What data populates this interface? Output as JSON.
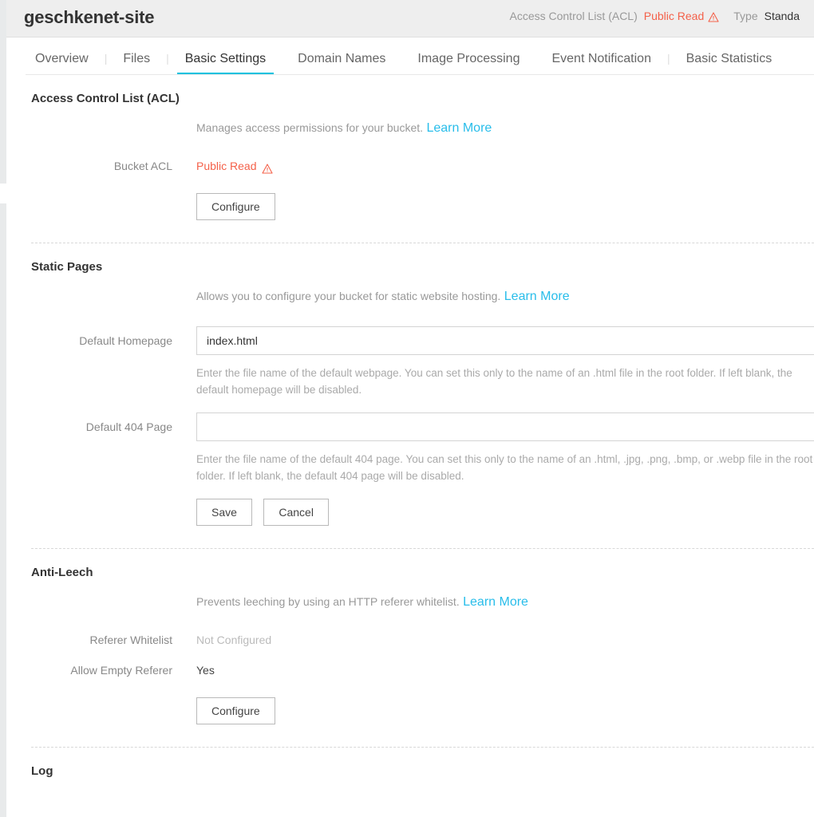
{
  "header": {
    "bucket_name": "geschkenet-site",
    "acl_label": "Access Control List (ACL)",
    "acl_value": "Public Read",
    "type_label": "Type",
    "type_value": "Standa"
  },
  "tabs": [
    {
      "label": "Overview",
      "active": false
    },
    {
      "label": "Files",
      "active": false
    },
    {
      "label": "Basic Settings",
      "active": true
    },
    {
      "label": "Domain Names",
      "active": false
    },
    {
      "label": "Image Processing",
      "active": false
    },
    {
      "label": "Event Notification",
      "active": false
    },
    {
      "label": "Basic Statistics",
      "active": false
    }
  ],
  "sections": {
    "acl": {
      "title": "Access Control List (ACL)",
      "description": "Manages access permissions for your bucket.",
      "learn_more": "Learn More",
      "bucket_acl_label": "Bucket ACL",
      "bucket_acl_value": "Public Read",
      "configure_button": "Configure"
    },
    "static_pages": {
      "title": "Static Pages",
      "description": "Allows you to configure your bucket for static website hosting.",
      "learn_more": "Learn More",
      "homepage_label": "Default Homepage",
      "homepage_value": "index.html",
      "homepage_placeholder": "",
      "homepage_helper": "Enter the file name of the default webpage. You can set this only to the name of an .html file in the root folder. If left blank, the default homepage will be disabled.",
      "notfound_label": "Default 404 Page",
      "notfound_value": "",
      "notfound_placeholder": "",
      "notfound_helper": "Enter the file name of the default 404 page. You can set this only to the name of an .html, .jpg, .png, .bmp, or .webp file in the root folder. If left blank, the default 404 page will be disabled.",
      "save_button": "Save",
      "cancel_button": "Cancel"
    },
    "anti_leech": {
      "title": "Anti-Leech",
      "description": "Prevents leeching by using an HTTP referer whitelist.",
      "learn_more": "Learn More",
      "referer_whitelist_label": "Referer Whitelist",
      "referer_whitelist_value": "Not Configured",
      "allow_empty_referer_label": "Allow Empty Referer",
      "allow_empty_referer_value": "Yes",
      "configure_button": "Configure"
    },
    "log": {
      "title": "Log"
    }
  },
  "colors": {
    "accent": "#00c1de",
    "link": "#28bdea",
    "warning": "#f4614a"
  }
}
